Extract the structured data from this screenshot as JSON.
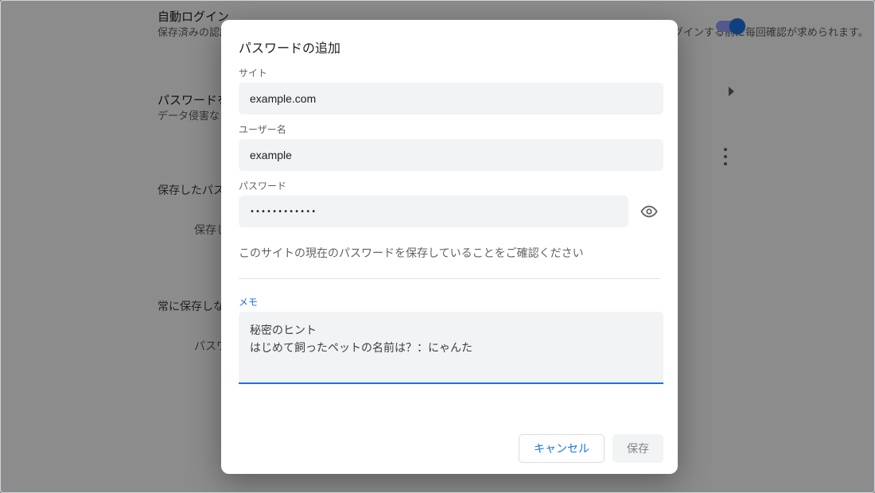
{
  "background": {
    "section1_title": "自動ログイン",
    "section1_sub": "保存済みの認証情報を使用してウェブサイトに自動的にログインします。この機能をオフにすると、サイトにログインする前に毎回確認が求められます。",
    "section2_title": "パスワードを確認",
    "section2_sub": "データ侵害などのセキュリティの問題からパスワードを保護します",
    "section3_label": "保存したパスワード",
    "section3_inner": "保存したパスワードはここに表示されます",
    "section4_label": "常に保存しない",
    "section4_inner": "パスワードを保存しないサイトがここに表示されます"
  },
  "dialog": {
    "title": "パスワードの追加",
    "site_label": "サイト",
    "site_value": "example.com",
    "username_label": "ユーザー名",
    "username_value": "example",
    "password_label": "パスワード",
    "password_value": "••••••••••••",
    "helper": "このサイトの現在のパスワードを保存していることをご確認ください",
    "memo_label": "メモ",
    "memo_value": "秘密のヒント\nはじめて飼ったペットの名前は？：にゃんた",
    "cancel": "キャンセル",
    "save": "保存"
  }
}
